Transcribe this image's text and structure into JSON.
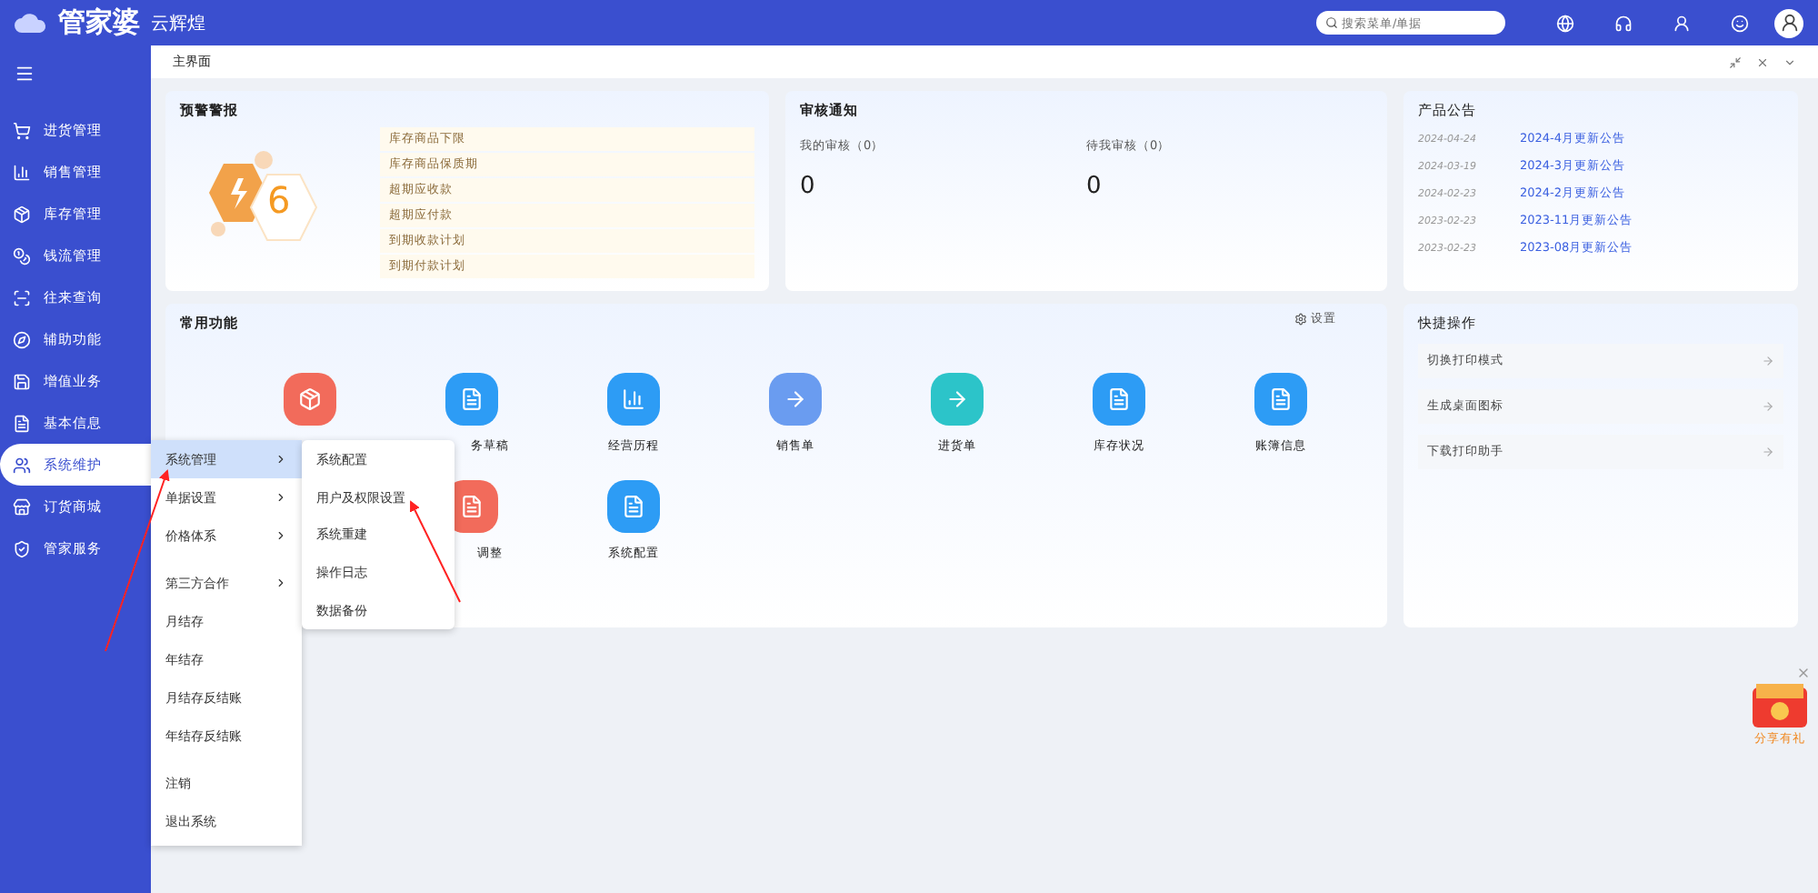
{
  "app": {
    "logo_main": "管家婆",
    "logo_sub": "云辉煌",
    "search": {
      "placeholder": "搜索菜单/单据"
    }
  },
  "tabs": [
    {
      "label": "主界面",
      "selected": true
    }
  ],
  "sidebar": {
    "items": [
      {
        "label": "进货管理",
        "selected": false
      },
      {
        "label": "销售管理",
        "selected": false
      },
      {
        "label": "库存管理",
        "selected": false
      },
      {
        "label": "钱流管理",
        "selected": false
      },
      {
        "label": "往来查询",
        "selected": false
      },
      {
        "label": "辅助功能",
        "selected": false
      },
      {
        "label": "增值业务",
        "selected": false
      },
      {
        "label": "基本信息",
        "selected": false
      },
      {
        "label": "系统维护",
        "selected": true
      },
      {
        "label": "订货商城",
        "selected": false
      },
      {
        "label": "管家服务",
        "selected": false
      }
    ]
  },
  "menu": [
    {
      "label": "系统管理",
      "submenu": true,
      "selected": true
    },
    {
      "label": "单据设置",
      "submenu": true,
      "selected": false
    },
    {
      "label": "价格体系",
      "submenu": true,
      "selected": false
    },
    {
      "label": "第三方合作",
      "submenu": true,
      "selected": false
    },
    {
      "label": "月结存",
      "submenu": false,
      "selected": false
    },
    {
      "label": "年结存",
      "submenu": false,
      "selected": false
    },
    {
      "label": "月结存反结账",
      "submenu": false,
      "selected": false
    },
    {
      "label": "年结存反结账",
      "submenu": false,
      "selected": false
    },
    {
      "label": "注销",
      "submenu": false,
      "selected": false
    },
    {
      "label": "退出系统",
      "submenu": false,
      "selected": false
    }
  ],
  "submenu": [
    "系统配置",
    "用户及权限设置",
    "系统重建",
    "操作日志",
    "数据备份"
  ],
  "warning": {
    "title": "预警警报",
    "count": "6",
    "items": [
      "库存商品下限",
      "库存商品保质期",
      "超期应收款",
      "超期应付款",
      "到期收款计划",
      "到期付款计划"
    ]
  },
  "audit": {
    "title": "审核通知",
    "columns": [
      {
        "label": "我的审核（0）",
        "value": "0"
      },
      {
        "label": "待我审核（0）",
        "value": "0"
      }
    ]
  },
  "notices": {
    "title": "产品公告",
    "items": [
      {
        "date": "2024-04-24",
        "title": "2024-4月更新公告"
      },
      {
        "date": "2024-03-19",
        "title": "2024-3月更新公告"
      },
      {
        "date": "2024-02-23",
        "title": "2024-2月更新公告"
      },
      {
        "date": "2023-02-23",
        "title": "2023-11月更新公告"
      },
      {
        "date": "2023-02-23",
        "title": "2023-08月更新公告"
      }
    ]
  },
  "common": {
    "title": "常用功能",
    "settings": "设置",
    "rows": [
      [
        {
          "color": "#f26b5b"
        },
        {
          "label": "务草稿",
          "color": "#2d9cf5"
        },
        {
          "label": "经营历程",
          "color": "#2d9cf5"
        },
        {
          "label": "销售单",
          "color": "#6a9cf0"
        },
        {
          "label": "进货单",
          "color": "#2cc4c9"
        },
        {
          "label": "库存状况",
          "color": "#2d9cf5"
        },
        {
          "label": "账簿信息",
          "color": "#2d9cf5"
        }
      ],
      [
        "",
        {
          "label": "调整",
          "color": "#f26b5b"
        },
        {
          "label": "系统配置",
          "color": "#2d9cf5"
        }
      ]
    ]
  },
  "quick": {
    "title": "快捷操作",
    "items": [
      "切换打印模式",
      "生成桌面图标",
      "下载打印助手"
    ]
  },
  "promo": {
    "label": "分享有礼"
  }
}
